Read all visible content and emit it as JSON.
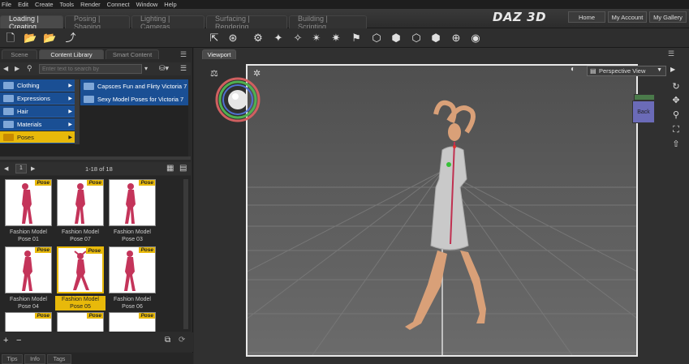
{
  "menu": [
    "File",
    "Edit",
    "Create",
    "Tools",
    "Render",
    "Connect",
    "Window",
    "Help"
  ],
  "workflow_tabs": [
    "Loading | Creating",
    "Posing | Shaping",
    "Lighting | Cameras",
    "Surfacing | Rendering",
    "Building | Scripting"
  ],
  "logo": "DAZ 3D",
  "header_buttons": {
    "home": "Home",
    "account": "My Account",
    "gallery": "My Gallery"
  },
  "panel_tabs": [
    "Scene",
    "Content Library",
    "Smart Content"
  ],
  "search": {
    "placeholder": "Enter text to search by"
  },
  "folders": [
    "Clothing",
    "Expressions",
    "Hair",
    "Materials",
    "Poses"
  ],
  "subfolders": [
    "Capsces Fun and Flirty Victoria 7",
    "Sexy Model Poses for Victoria 7"
  ],
  "pager": {
    "page": "1",
    "range": "1-18 of 18"
  },
  "badge": "Pose",
  "thumbnails": [
    {
      "line1": "Fashion Model",
      "line2": "Pose 01"
    },
    {
      "line1": "Fashion Model",
      "line2": "Pose 07"
    },
    {
      "line1": "Fashion Model",
      "line2": "Pose 03"
    },
    {
      "line1": "Fashion Model",
      "line2": "Pose 04"
    },
    {
      "line1": "Fashion Model",
      "line2": "Pose 05"
    },
    {
      "line1": "Fashion Model",
      "line2": "Pose 06"
    }
  ],
  "viewport": {
    "tab": "Viewport",
    "view": "Perspective View",
    "cube_face": "Back"
  },
  "bottom_tabs": [
    "Tips",
    "Info",
    "Tags"
  ],
  "colors": {
    "selection": "#e8b90a",
    "folder_blue": "#1a4f94"
  }
}
